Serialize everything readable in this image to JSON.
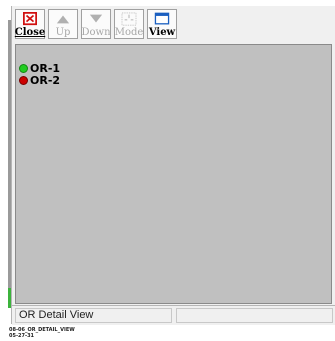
{
  "toolbar": {
    "close_label": "Close",
    "up_label": "Up",
    "down_label": "Down",
    "mode_label": "Mode",
    "view_label": "View"
  },
  "or_list": [
    {
      "label": "OR-1",
      "status_color": "#22cc22"
    },
    {
      "label": "OR-2",
      "status_color": "#cc0000"
    }
  ],
  "status_bar": {
    "pane1": "OR Detail View",
    "pane2": ""
  },
  "caption": {
    "line1": "08-06_OR_DETAIL_VIEW",
    "line2": "05-27-31"
  }
}
